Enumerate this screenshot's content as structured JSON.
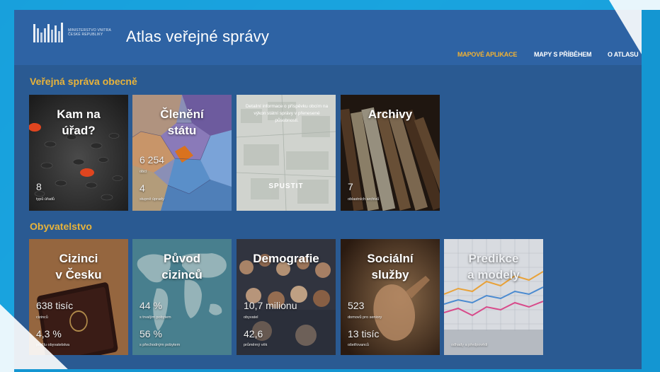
{
  "header": {
    "ministry_line1": "MINISTERSTVO VNITRA",
    "ministry_line2": "ČESKÉ REPUBLIKY",
    "site_title": "Atlas veřejné správy",
    "nav": [
      {
        "label": "MAPOVÉ APLIKACE",
        "active": true
      },
      {
        "label": "MAPY S PŘÍBĚHEM",
        "active": false
      },
      {
        "label": "O ATLASU",
        "active": false
      }
    ]
  },
  "sections": [
    {
      "title": "Veřejná správa obecně",
      "tiles": [
        {
          "title_lines": [
            "Kam na",
            "úřad?"
          ],
          "stats": [
            {
              "value": "8",
              "label": "typů úřadů"
            }
          ]
        },
        {
          "title_lines": [
            "Členění",
            "státu"
          ],
          "stats": [
            {
              "value": "6 254",
              "label": "obcí"
            },
            {
              "value": "4",
              "label": "stupně úprady"
            }
          ]
        },
        {
          "description": "Detailní informace o příspěvku obcím na výkon státní správy v přenesené působnosti.",
          "button": "SPUSTIT"
        },
        {
          "title_lines": [
            "Archivy"
          ],
          "stats": [
            {
              "value": "7",
              "label": "oblastních archivů"
            }
          ]
        }
      ]
    },
    {
      "title": "Obyvatelstvo",
      "tiles": [
        {
          "title_lines": [
            "Cizinci",
            "v Česku"
          ],
          "stats": [
            {
              "value": "638 tisíc",
              "label": "cizinců"
            },
            {
              "value": "4,3 %",
              "label": "podílu obyvatelstva"
            }
          ]
        },
        {
          "title_lines": [
            "Původ",
            "cizinců"
          ],
          "stats": [
            {
              "value": "44 %",
              "label": "s trvalým pobytem"
            },
            {
              "value": "56 %",
              "label": "s přechodným pobytem"
            }
          ]
        },
        {
          "title_lines": [
            "Demografie"
          ],
          "stats": [
            {
              "value": "10,7 milionu",
              "label": "obyvatel"
            },
            {
              "value": "42,6",
              "label": "průměrný věk"
            }
          ]
        },
        {
          "title_lines": [
            "Sociální",
            "služby"
          ],
          "stats": [
            {
              "value": "523",
              "label": "domovů pro seniory"
            },
            {
              "value": "13 tisíc",
              "label": "ošetřovanců"
            }
          ]
        },
        {
          "title_lines": [
            "Predikce",
            "a modely"
          ],
          "stats": [
            {
              "value": "",
              "label": "odhady a předpovědi"
            }
          ]
        }
      ]
    }
  ],
  "colors": {
    "accent": "#e8b33a",
    "header": "#2e63a4",
    "body": "#2a5a92",
    "frame": "#159ad6"
  }
}
